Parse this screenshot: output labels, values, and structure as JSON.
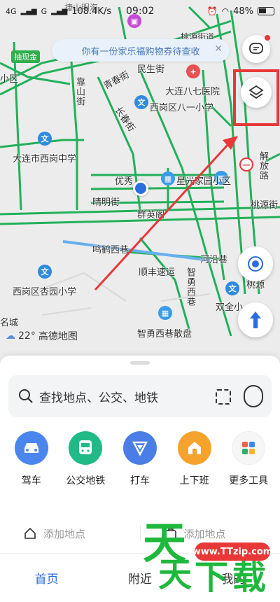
{
  "status_bar": {
    "signal_left": "4G",
    "signal_right": "G",
    "speed": "108.4K/s",
    "time": "09:02",
    "battery": "48%"
  },
  "banner": {
    "text": "你有一份家乐福购物券待查收"
  },
  "map": {
    "labels": {
      "top_left": "捷山明海",
      "top_right": "桃源街道",
      "promo": "抽现金",
      "xiaoqu": "小区",
      "minsheng": "民生街",
      "dalian_b7": "大连八七医院",
      "qingchun": "青春街",
      "kaoshan": "靠山街",
      "changchun": "长春街",
      "xigang_b1": "西岗区八一小学",
      "dalian_xigang_zx": "大连市西岗中学",
      "youxiu": "优秀",
      "xingguang": "星光家园小区",
      "qingming": "晴明街",
      "gongying": "群英阁",
      "jiefang": "解放路",
      "taoyuan_st": "桃源街",
      "xihe": "鸣鹤西巷",
      "hejiang": "河沿巷",
      "shunfeng": "顺丰速运",
      "zhiyong": "智勇西巷",
      "xigang_xingyuan": "西岗区杏园小学",
      "shuangquan": "双全小",
      "zhiyong_sanpu": "智勇西巷散盘",
      "taoyuan2": "桃源",
      "mingcheng": "名城"
    }
  },
  "weather": {
    "temp": "22°",
    "source": "高德地图"
  },
  "search": {
    "placeholder": "查找地点、公交、地铁"
  },
  "quick_actions": [
    {
      "label": "驾车",
      "color": "#4a86ee",
      "icon": "car-icon"
    },
    {
      "label": "公交地铁",
      "color": "#1fba86",
      "icon": "bus-icon"
    },
    {
      "label": "打车",
      "color": "#4a7de6",
      "icon": "taxi-icon"
    },
    {
      "label": "上下班",
      "color": "#f5a32c",
      "icon": "commute-icon"
    },
    {
      "label": "更多工具",
      "color": "#f3f3f3",
      "icon": "grid-icon"
    }
  ],
  "places": {
    "home": "添加地点",
    "work": "添加地点"
  },
  "tabs": {
    "home": "首页",
    "nearby": "附近",
    "mine": "我的"
  },
  "watermark": {
    "chars": "天天下载",
    "url": "www.TTzip.com"
  }
}
